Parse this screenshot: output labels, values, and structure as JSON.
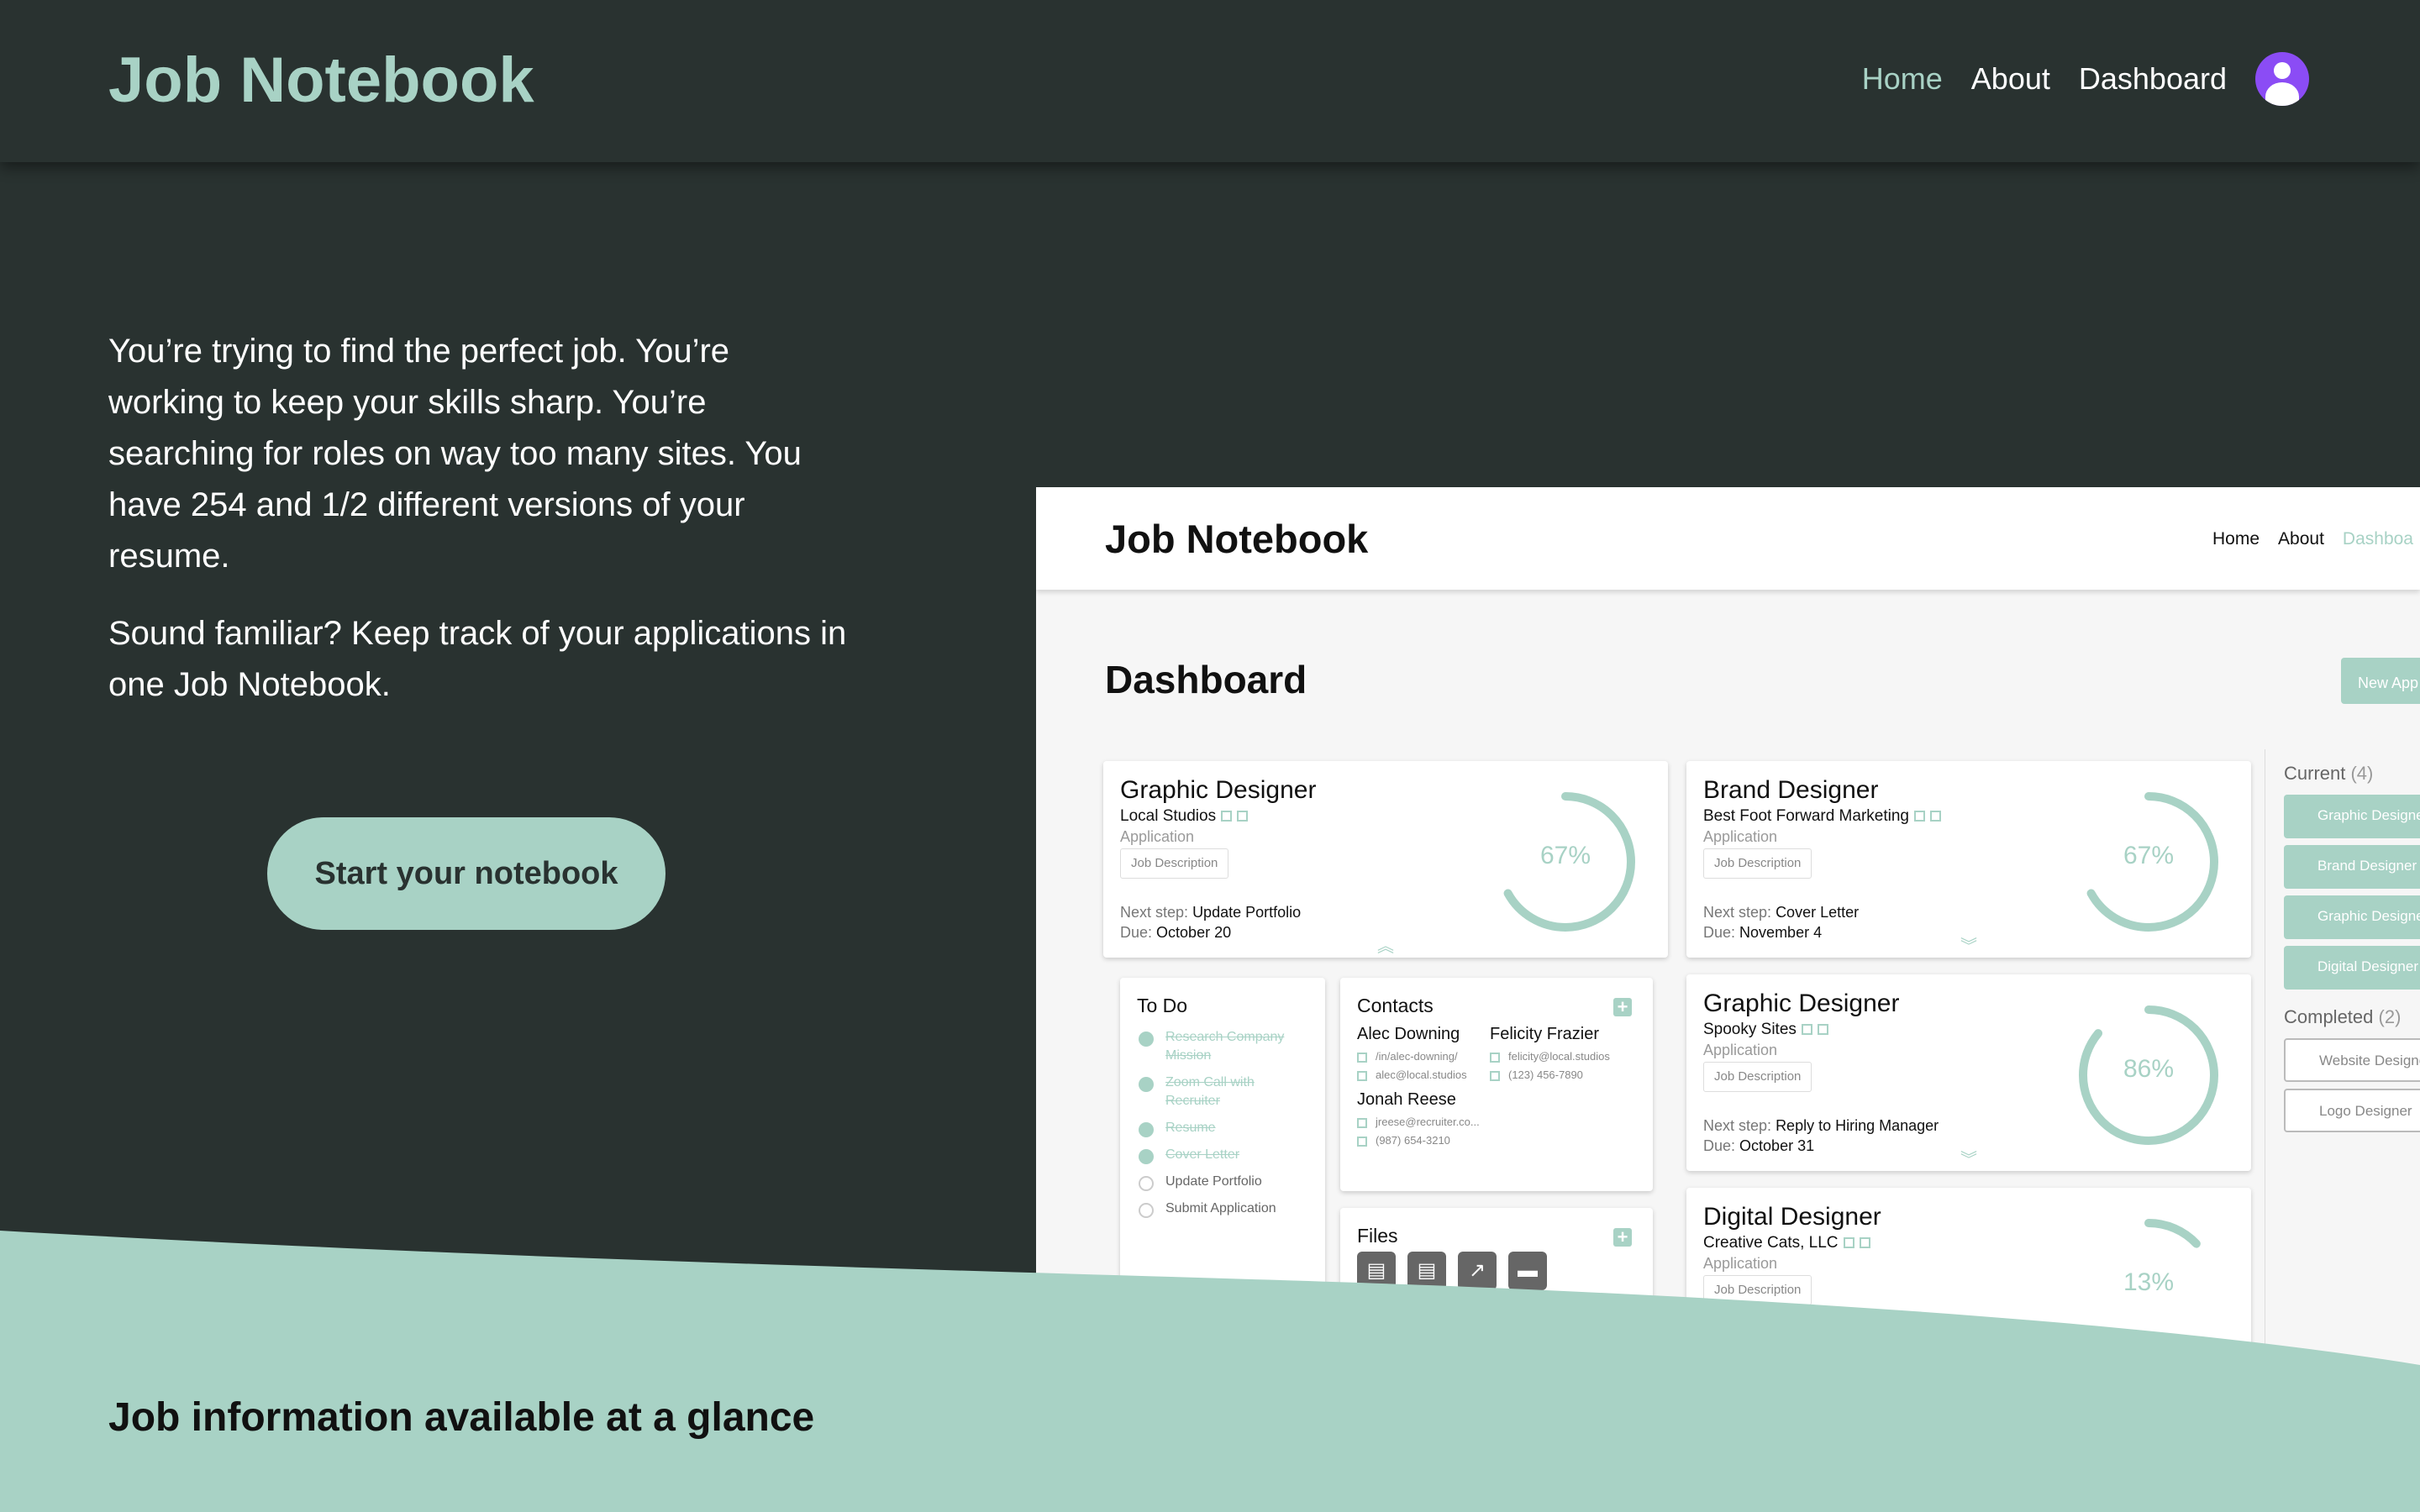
{
  "header": {
    "brand": "Job Notebook",
    "nav": [
      "Home",
      "About",
      "Dashboard"
    ],
    "avatar_icon": "user-avatar-icon"
  },
  "hero": {
    "paragraph_1": "You’re trying to find the perfect job. You’re working to keep your skills sharp. You’re searching for roles on way too many sites. You have 254 and 1/2 different versions of your resume.",
    "paragraph_2": "Sound familiar? Keep track of your applications in one Job Notebook.",
    "cta": "Start your notebook"
  },
  "preview": {
    "brand": "Job Notebook",
    "nav": [
      "Home",
      "About",
      "Dashboa"
    ],
    "title": "Dashboard",
    "new_button": "New App",
    "jobs": [
      {
        "title": "Graphic Designer",
        "company": "Local Studios",
        "type": "Application",
        "desc": "Job Description",
        "next_label": "Next step:",
        "next": "Update Portfolio",
        "due_label": "Due:",
        "due": "October 20",
        "progress": 67,
        "progress_label": "67%"
      },
      {
        "title": "Brand Designer",
        "company": "Best Foot Forward Marketing",
        "type": "Application",
        "desc": "Job Description",
        "next_label": "Next step:",
        "next": "Cover Letter",
        "due_label": "Due:",
        "due": "November 4",
        "progress": 67,
        "progress_label": "67%"
      },
      {
        "title": "Graphic Designer",
        "company": "Spooky Sites",
        "type": "Application",
        "desc": "Job Description",
        "next_label": "Next step:",
        "next": "Reply to Hiring Manager",
        "due_label": "Due:",
        "due": "October 31",
        "progress": 86,
        "progress_label": "86%"
      },
      {
        "title": "Digital Designer",
        "company": "Creative Cats, LLC",
        "type": "Application",
        "desc": "Job Description",
        "progress": 13,
        "progress_label": "13%"
      }
    ],
    "todo": {
      "title": "To Do",
      "items": [
        {
          "label": "Research Company Mission",
          "done": true
        },
        {
          "label": "Zoom Call with Recruiter",
          "done": true
        },
        {
          "label": "Resume",
          "done": true
        },
        {
          "label": "Cover Letter",
          "done": true
        },
        {
          "label": "Update Portfolio",
          "done": false
        },
        {
          "label": "Submit Application",
          "done": false
        }
      ]
    },
    "contacts": {
      "title": "Contacts",
      "people": [
        {
          "name": "Alec Downing",
          "linkedin": "/in/alec-downing/",
          "email": "alec@local.studios"
        },
        {
          "name": "Felicity Frazier",
          "email": "felicity@local.studios",
          "phone": "(123) 456-7890"
        },
        {
          "name": "Jonah Reese",
          "email": "jreese@recruiter.co...",
          "phone": "(987) 654-3210"
        }
      ]
    },
    "files": {
      "title": "Files"
    },
    "sidebar": {
      "current_label": "Current",
      "current_count": "(4)",
      "current": [
        "Graphic Designer",
        "Brand Designer",
        "Graphic Designer",
        "Digital Designer"
      ],
      "completed_label": "Completed",
      "completed_count": "(2)",
      "completed": [
        "Website Designer",
        "Logo Designer"
      ]
    }
  },
  "section": {
    "title": "Job information available at a glance"
  },
  "colors": {
    "background": "#293230",
    "accent": "#a8d2c5",
    "avatar": "#8b4cf5"
  }
}
